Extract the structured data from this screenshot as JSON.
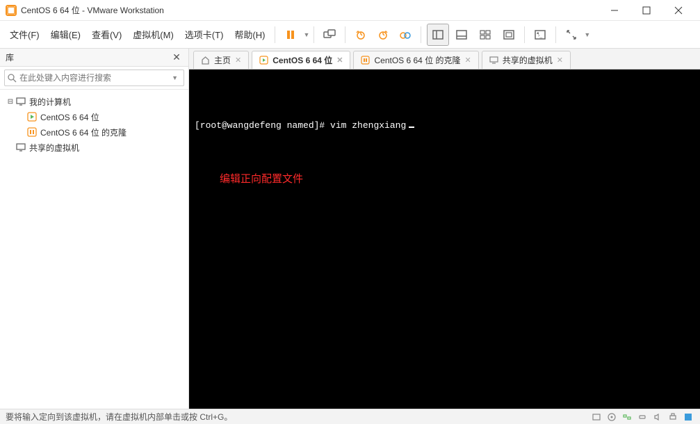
{
  "window": {
    "title": "CentOS 6 64 位 - VMware Workstation"
  },
  "menu": {
    "file": "文件(F)",
    "edit": "编辑(E)",
    "view": "查看(V)",
    "vm": "虚拟机(M)",
    "tabs": "选项卡(T)",
    "help": "帮助(H)"
  },
  "sidebar": {
    "title": "库",
    "search_placeholder": "在此处键入内容进行搜索",
    "root": "我的计算机",
    "items": [
      "CentOS 6 64 位",
      "CentOS 6 64 位 的克隆"
    ],
    "shared": "共享的虚拟机"
  },
  "tabs": {
    "home": "主页",
    "active": "CentOS 6 64 位",
    "clone": "CentOS 6 64 位 的克隆",
    "shared": "共享的虚拟机"
  },
  "terminal": {
    "line": "[root@wangdefeng named]# vim zhengxiang",
    "annotation": "编辑正向配置文件"
  },
  "status": {
    "message": "要将输入定向到该虚拟机，请在虚拟机内部单击或按 Ctrl+G。"
  }
}
